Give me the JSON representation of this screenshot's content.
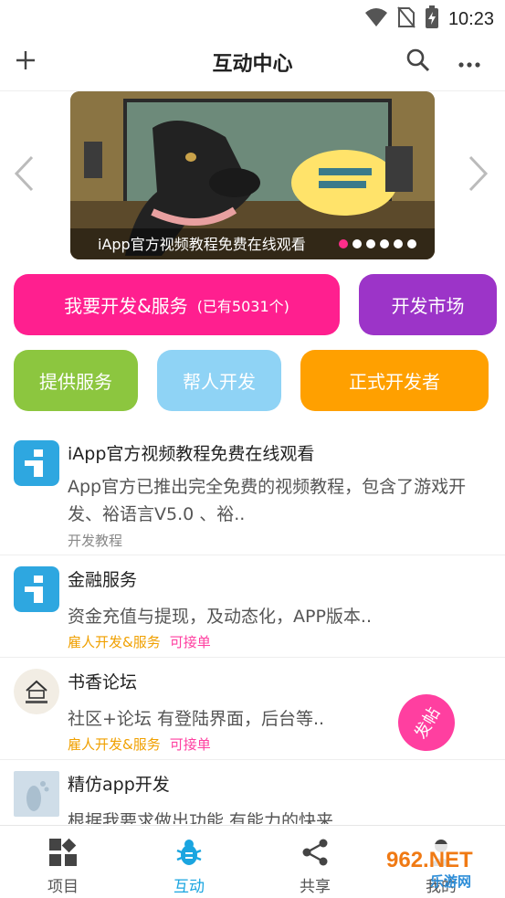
{
  "status_bar": {
    "time": "10:23"
  },
  "app_bar": {
    "title": "互动中心"
  },
  "banner": {
    "caption": "iApp官方视频教程免费在线观看",
    "dot_count": 6,
    "active_dot": 0
  },
  "actions": {
    "develop_service": {
      "label": "我要开发&服务",
      "sub": "(已有5031个)",
      "color": "#ff1f8f"
    },
    "dev_market": {
      "label": "开发市场",
      "color": "#9c34c8"
    },
    "provide_service": {
      "label": "提供服务",
      "color": "#8cc63f"
    },
    "help_develop": {
      "label": "帮人开发",
      "color": "#8fd3f5"
    },
    "formal_developer": {
      "label": "正式开发者",
      "color": "#ffa000"
    }
  },
  "feed": [
    {
      "title": "iApp官方视频教程免费在线观看",
      "desc": "App官方已推出完全免费的视频教程，包含了游戏开发、裕语言V5.0 、裕..",
      "tags": [
        {
          "text": "开发教程",
          "style": "plain"
        }
      ],
      "avatar": "iapp-logo-icon"
    },
    {
      "title": "金融服务",
      "desc": "资金充值与提现，及动态化，APP版本..",
      "tags": [
        {
          "text": "雇人开发&服务",
          "style": "orange"
        },
        {
          "text": "可接单",
          "style": "pink"
        }
      ],
      "avatar": "iapp-logo-icon"
    },
    {
      "title": "书香论坛",
      "desc": "社区+论坛 有登陆界面，后台等..",
      "tags": [
        {
          "text": "雇人开发&服务",
          "style": "orange"
        },
        {
          "text": "可接单",
          "style": "pink"
        }
      ],
      "avatar": "book-house-icon"
    },
    {
      "title": "精仿app开发",
      "desc": "根据我要求做出功能 有能力的快来",
      "tags": [],
      "avatar": "footprint-photo"
    }
  ],
  "fab": {
    "label": "发帖"
  },
  "bottom_nav": [
    {
      "label": "项目",
      "icon": "grid-icon"
    },
    {
      "label": "互动",
      "icon": "bug-icon",
      "active": true
    },
    {
      "label": "共享",
      "icon": "share-icon"
    },
    {
      "label": "我的",
      "icon": "person-icon"
    }
  ],
  "watermark": {
    "text": "962.NET",
    "sub": "乐游网"
  },
  "colors": {
    "accent": "#1aa5e0",
    "pink": "#ff3fa0",
    "orange": "#f0a000"
  }
}
